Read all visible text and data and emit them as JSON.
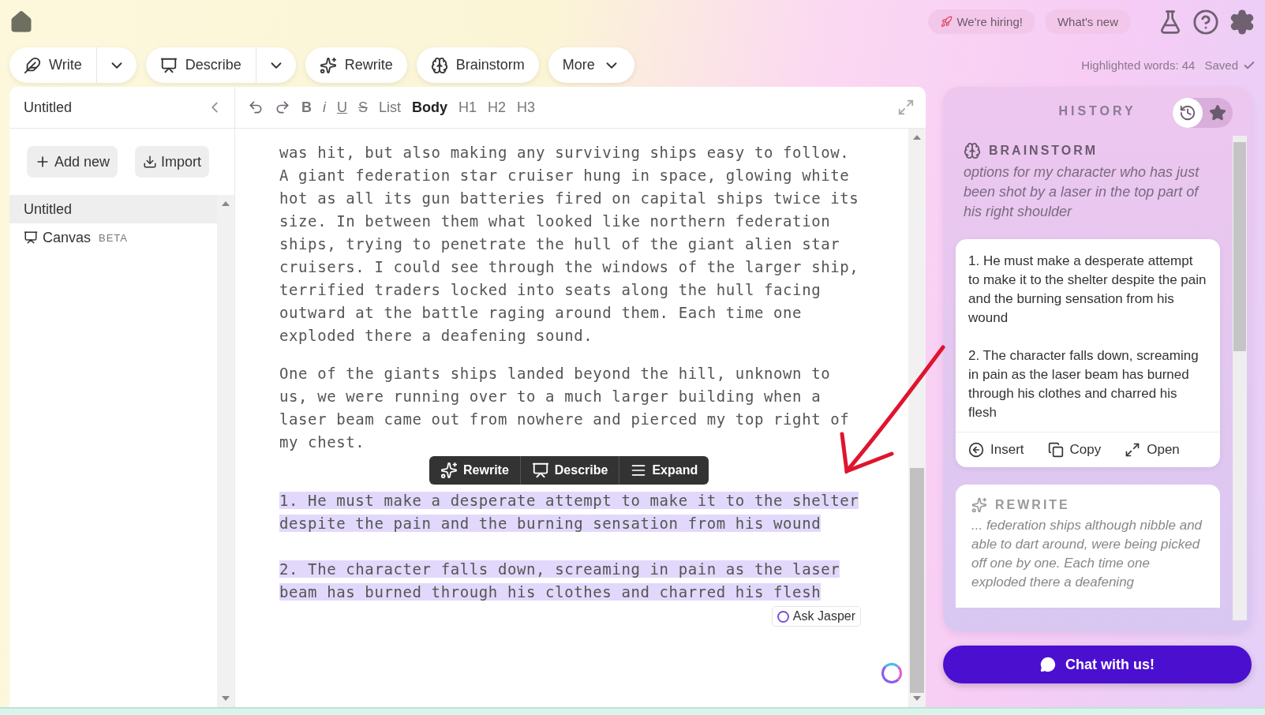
{
  "top_links": [
    {
      "label": "We're hiring!",
      "kind": "hiring"
    },
    {
      "label": "What's new",
      "kind": "plain"
    }
  ],
  "actions": [
    {
      "label": "Write",
      "kind": "write",
      "dropdown": true
    },
    {
      "label": "Describe",
      "kind": "describe",
      "dropdown": true
    },
    {
      "label": "Rewrite",
      "kind": "rewrite",
      "dropdown": false
    },
    {
      "label": "Brainstorm",
      "kind": "brainstorm",
      "dropdown": false
    },
    {
      "label": "More",
      "kind": "more",
      "dropdown": true
    }
  ],
  "status": {
    "highlighted": "Highlighted words: 44",
    "saved": "Saved"
  },
  "sidebar": {
    "title": "Untitled",
    "buttons": [
      {
        "label": "Add new",
        "kind": "add"
      },
      {
        "label": "Import",
        "kind": "import"
      }
    ],
    "items": [
      {
        "label": "Untitled",
        "kind": "doc",
        "selected": true
      },
      {
        "label": "Canvas",
        "badge": "BETA",
        "kind": "canvas",
        "selected": false
      }
    ]
  },
  "format_toolbar": [
    {
      "kind": "undo"
    },
    {
      "kind": "redo"
    },
    {
      "kind": "bold",
      "label": "B",
      "selected": false
    },
    {
      "kind": "italic",
      "label": "i",
      "selected": false
    },
    {
      "kind": "underline",
      "label": "U",
      "selected": false
    },
    {
      "kind": "strike",
      "label": "S",
      "selected": false
    },
    {
      "kind": "text",
      "label": "List",
      "selected": false
    },
    {
      "kind": "text",
      "label": "Body",
      "selected": true
    },
    {
      "kind": "text",
      "label": "H1",
      "selected": false
    },
    {
      "kind": "text",
      "label": "H2",
      "selected": false
    },
    {
      "kind": "text",
      "label": "H3",
      "selected": false
    }
  ],
  "editor": {
    "paragraphs": [
      {
        "text": "was hit, but also making any surviving ships easy to follow. A giant federation star cruiser hung in space, glowing white hot as all its gun batteries fired on capital ships twice its size. In between them what looked like northern federation ships, trying to penetrate the hull of the giant alien star cruisers. I could see through the windows of the larger ship, terrified traders locked into seats along the hull facing outward at the battle raging around them. Each time one exploded there a deafening sound.",
        "highlighted": false
      },
      {
        "text": "One of the giants ships landed beyond the hill, unknown to us, we were running over to a much larger building when a laser beam came out from nowhere and pierced my top right of my chest.",
        "highlighted": false
      },
      {
        "text": "1. He must make a desperate attempt to make it to the shelter despite the pain and the burning sensation from his wound",
        "highlighted": true
      },
      {
        "text": "2. The character falls down, screaming in pain as the laser beam has burned through his clothes and charred his flesh",
        "highlighted": true
      }
    ],
    "popup": [
      {
        "label": "Rewrite",
        "kind": "rewrite"
      },
      {
        "label": "Describe",
        "kind": "describe"
      },
      {
        "label": "Expand",
        "kind": "expand"
      }
    ],
    "ask": "Ask Jasper"
  },
  "history": {
    "title": "HISTORY",
    "views": [
      {
        "kind": "history",
        "selected": true
      },
      {
        "kind": "favorites",
        "selected": false
      }
    ],
    "entries": [
      {
        "kind": "brainstorm",
        "label": "BRAINSTORM",
        "prompt": "options for my character who has just been shot by a laser in the top part of his right shoulder",
        "outputs": [
          "1. He must make a desperate attempt to make it to the shelter despite the pain and the burning sensation from his wound",
          "2. The character falls down, screaming in pain as the laser beam has burned through his clothes and charred his flesh"
        ],
        "buttons": [
          {
            "label": "Insert",
            "kind": "insert"
          },
          {
            "label": "Copy",
            "kind": "copy"
          },
          {
            "label": "Open",
            "kind": "open"
          }
        ]
      },
      {
        "kind": "rewrite",
        "label": "REWRITE",
        "prompt": "... federation ships although nibble and able to dart around, were being picked off one by one. Each time one exploded there a deafening"
      }
    ]
  },
  "chat": "Chat with us!"
}
